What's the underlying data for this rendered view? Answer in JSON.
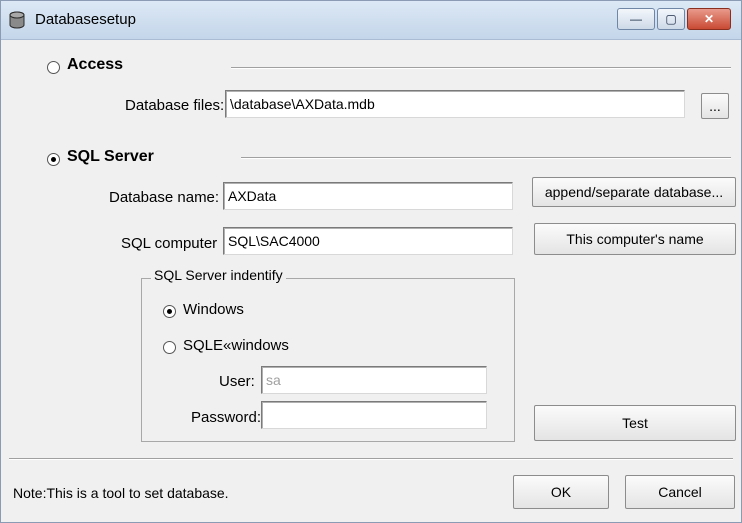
{
  "window": {
    "title": "Databasesetup",
    "close_glyph": "✕",
    "minimize_glyph": "—",
    "maximize_glyph": "▢"
  },
  "access": {
    "label": "Access",
    "selected": false,
    "db_files_label": "Database files:",
    "db_files_value": "\\database\\AXData.mdb",
    "browse_label": "..."
  },
  "sql": {
    "label": "SQL Server",
    "selected": true,
    "db_name_label": "Database name:",
    "db_name_value": "AXData",
    "append_button": "append/separate database...",
    "computer_label": "SQL computer",
    "computer_value": "SQL\\SAC4000",
    "computer_name_button": "This computer's name",
    "identify": {
      "legend": "SQL Server indentify",
      "windows_label": "Windows",
      "windows_selected": true,
      "sql_label": "SQLE«windows",
      "sql_selected": false,
      "user_label": "User:",
      "user_value": "sa",
      "password_label": "Password:",
      "password_value": ""
    },
    "test_button": "Test"
  },
  "footer": {
    "note": "Note:This is a tool to set database.",
    "ok": "OK",
    "cancel": "Cancel"
  },
  "icons": [
    "database-icon",
    "minimize-icon",
    "maximize-icon",
    "close-icon"
  ]
}
